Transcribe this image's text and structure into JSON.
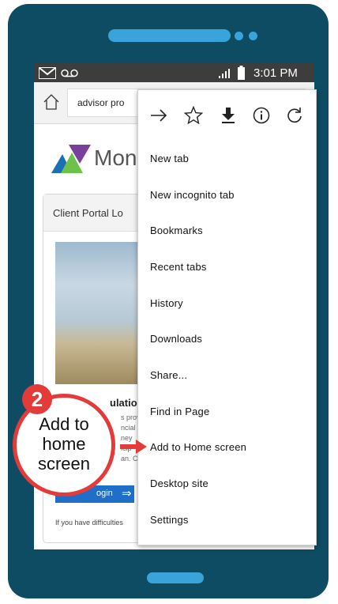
{
  "statusbar": {
    "time": "3:01 PM"
  },
  "browser": {
    "url_partial": "advisor pro"
  },
  "page": {
    "logo_partial": "Mone",
    "card_title_partial": "Client Portal Lo",
    "heading_partial": "ulation",
    "body_lines": [
      "s prov",
      "ncial",
      "ney",
      "icip",
      "an. Cli"
    ],
    "login_label": "ogin",
    "footer_text": "If you have difficulties"
  },
  "menu": {
    "items": [
      "New tab",
      "New incognito tab",
      "Bookmarks",
      "Recent tabs",
      "History",
      "Downloads",
      "Share...",
      "Find in Page",
      "Add to Home screen",
      "Desktop site",
      "Settings"
    ]
  },
  "callout": {
    "step": "2",
    "lines": [
      "Add to",
      "home",
      "screen"
    ]
  },
  "colors": {
    "phone": "#0d4c63",
    "accent_blue": "#3aa3da",
    "callout_red": "#e33a3a",
    "login_blue": "#1f6fc8"
  }
}
